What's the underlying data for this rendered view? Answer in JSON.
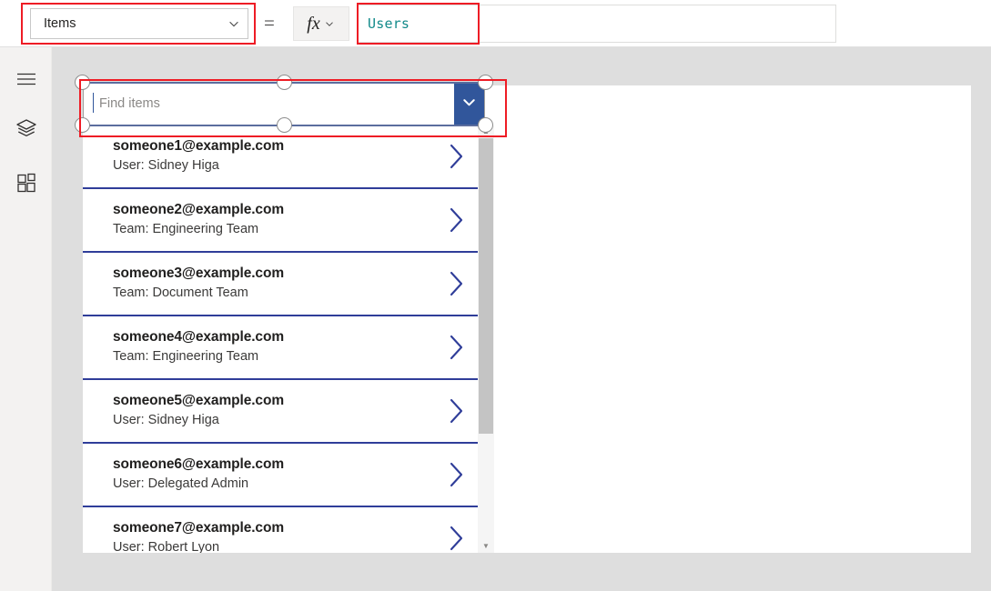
{
  "formula_bar": {
    "property_dropdown": {
      "value": "Items",
      "caret_icon": "chevron-down-icon"
    },
    "equals_sign": "=",
    "fx_button": {
      "glyph": "fx",
      "caret_icon": "chevron-down-icon"
    },
    "formula_value": "Users",
    "formula_color": "#128a8a"
  },
  "left_rail": {
    "items": [
      {
        "name": "hamburger-menu",
        "label": "Menu"
      },
      {
        "name": "tree-view",
        "label": "Tree view"
      },
      {
        "name": "insert",
        "label": "Insert"
      }
    ]
  },
  "combobox": {
    "placeholder": "Find items",
    "value": "",
    "dropdown_icon": "chevron-down-icon",
    "accent_color": "#31569b",
    "selected": true
  },
  "gallery": {
    "separator_color": "#2f3d99",
    "chevron_icon": "chevron-right-icon",
    "rows": [
      {
        "title": "someone1@example.com",
        "subtitle": "User: Sidney Higa"
      },
      {
        "title": "someone2@example.com",
        "subtitle": "Team: Engineering Team"
      },
      {
        "title": "someone3@example.com",
        "subtitle": "Team: Document Team"
      },
      {
        "title": "someone4@example.com",
        "subtitle": "Team: Engineering Team"
      },
      {
        "title": "someone5@example.com",
        "subtitle": "User: Sidney Higa"
      },
      {
        "title": "someone6@example.com",
        "subtitle": "User: Delegated Admin"
      },
      {
        "title": "someone7@example.com",
        "subtitle": "User: Robert Lyon"
      }
    ],
    "scrollbar": {
      "up_arrow": "▲",
      "down_arrow": "▼"
    }
  },
  "annotations": {
    "highlight_color": "#ee1c25",
    "boxes": [
      {
        "name": "property-dropdown-highlight"
      },
      {
        "name": "formula-input-highlight"
      },
      {
        "name": "combobox-highlight"
      }
    ]
  }
}
